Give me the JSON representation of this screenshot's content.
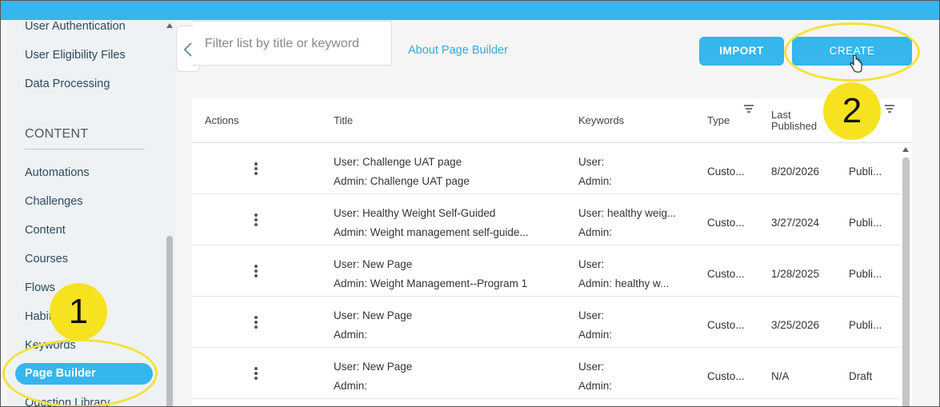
{
  "sidebar": {
    "items_top": [
      "User Authentication",
      "User Eligibility Files",
      "Data Processing"
    ],
    "section_heading": "CONTENT",
    "items_content": [
      "Automations",
      "Challenges",
      "Content",
      "Courses",
      "Flows",
      "Habits",
      "Keywords"
    ],
    "active_item": "Page Builder",
    "item_below": "Question Library"
  },
  "toolbar": {
    "filter_placeholder": "Filter list by title or keyword",
    "about_link": "About Page Builder",
    "import_label": "IMPORT",
    "create_label": "CREATE"
  },
  "table": {
    "headers": {
      "actions": "Actions",
      "title": "Title",
      "keywords": "Keywords",
      "type": "Type",
      "last_published_1": "Last",
      "last_published_2": "Published"
    },
    "rows": [
      {
        "title_user": "User: Challenge UAT page",
        "title_admin": "Admin: Challenge UAT page",
        "kw_user": "User:",
        "kw_admin": "Admin:",
        "type": "Custo...",
        "date": "8/20/2026",
        "status": "Publi..."
      },
      {
        "title_user": "User: Healthy Weight Self-Guided",
        "title_admin": "Admin: Weight management self-guide...",
        "kw_user": "User: healthy weig...",
        "kw_admin": "Admin:",
        "type": "Custo...",
        "date": "3/27/2024",
        "status": "Publi..."
      },
      {
        "title_user": "User: New Page",
        "title_admin": "Admin: Weight Management--Program 1",
        "kw_user": "User:",
        "kw_admin": "Admin: healthy w...",
        "type": "Custo...",
        "date": "1/28/2025",
        "status": "Publi..."
      },
      {
        "title_user": "User: New Page",
        "title_admin": "Admin:",
        "kw_user": "User:",
        "kw_admin": "Admin:",
        "type": "Custo...",
        "date": "3/25/2026",
        "status": "Publi..."
      },
      {
        "title_user": "User: New Page",
        "title_admin": "Admin:",
        "kw_user": "User:",
        "kw_admin": "Admin:",
        "type": "Custo...",
        "date": "N/A",
        "status": "Draft"
      }
    ]
  },
  "annotations": {
    "badge_1": "1",
    "badge_2": "2"
  },
  "colors": {
    "accent": "#35b6ec",
    "highlight_ring": "#f4e23a",
    "badge_fill": "#f7e21f"
  }
}
